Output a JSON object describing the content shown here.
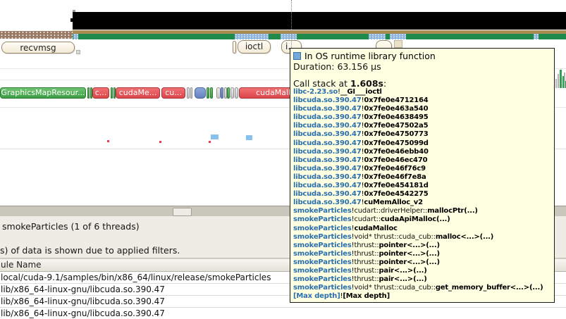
{
  "timeline": {
    "buttons": {
      "recvmsg": "recvmsg",
      "ioctl": "ioctl",
      "i_truncated": "i...",
      "dots": "..."
    },
    "bars": [
      "GraphicsMapResour...",
      "c...",
      "cudaMe...",
      "cu...",
      "cudaMalloc"
    ]
  },
  "tooltip": {
    "title": "In OS runtime library function",
    "duration": "Duration: 63.156 µs",
    "callstack_prefix": "Call stack at ",
    "callstack_time": "1.608s",
    "callstack_suffix": ":",
    "bang": "!",
    "stack": [
      {
        "module": "libc-2.23.so",
        "mid": "",
        "fn": "__GI___ioctl"
      },
      {
        "module": "libcuda.so.390.47",
        "mid": "",
        "fn": "0x7fe0e4712164"
      },
      {
        "module": "libcuda.so.390.47",
        "mid": "",
        "fn": "0x7fe0e463a540"
      },
      {
        "module": "libcuda.so.390.47",
        "mid": "",
        "fn": "0x7fe0e4638495"
      },
      {
        "module": "libcuda.so.390.47",
        "mid": "",
        "fn": "0x7fe0e47502a5"
      },
      {
        "module": "libcuda.so.390.47",
        "mid": "",
        "fn": "0x7fe0e4750773"
      },
      {
        "module": "libcuda.so.390.47",
        "mid": "",
        "fn": "0x7fe0e475099d"
      },
      {
        "module": "libcuda.so.390.47",
        "mid": "",
        "fn": "0x7fe0e46ebb40"
      },
      {
        "module": "libcuda.so.390.47",
        "mid": "",
        "fn": "0x7fe0e46ec470"
      },
      {
        "module": "libcuda.so.390.47",
        "mid": "",
        "fn": "0x7fe0e46f76c9"
      },
      {
        "module": "libcuda.so.390.47",
        "mid": "",
        "fn": "0x7fe0e46f7e8a"
      },
      {
        "module": "libcuda.so.390.47",
        "mid": "",
        "fn": "0x7fe0e454181d"
      },
      {
        "module": "libcuda.so.390.47",
        "mid": "",
        "fn": "0x7fe0e4542275"
      },
      {
        "module": "libcuda.so.390.47",
        "mid": "",
        "fn": "cuMemAlloc_v2"
      },
      {
        "module": "smokeParticles",
        "mid": "cudart::driverHelper::",
        "fn": "mallocPtr(...)"
      },
      {
        "module": "smokeParticles",
        "mid": "cudart::",
        "fn": "cudaApiMalloc(...)"
      },
      {
        "module": "smokeParticles",
        "mid": "",
        "fn": "cudaMalloc"
      },
      {
        "module": "smokeParticles",
        "mid": "void* thrust::cuda_cub::",
        "fn": "malloc<...>(...)"
      },
      {
        "module": "smokeParticles",
        "mid": "thrust::",
        "fn": "pointer<...>(...)"
      },
      {
        "module": "smokeParticles",
        "mid": "thrust::",
        "fn": "pointer<...>(...)"
      },
      {
        "module": "smokeParticles",
        "mid": "thrust::",
        "fn": "pointer<...>(...)"
      },
      {
        "module": "smokeParticles",
        "mid": "thrust::",
        "fn": "pair<...>(...)"
      },
      {
        "module": "smokeParticles",
        "mid": "thrust::",
        "fn": "pair<...>(...)"
      },
      {
        "module": "smokeParticles",
        "mid": "void* thrust::cuda_cub::",
        "fn": "get_memory_buffer<...>(...)"
      },
      {
        "module": "[Max depth]",
        "mid": "",
        "fn": "[Max depth]"
      }
    ]
  },
  "bottom": {
    "thread_info": "smokeParticles (1 of 6 threads)",
    "filter_notice": "s) of data is shown due to applied filters.",
    "table": {
      "header": "ule Name",
      "rows": [
        "local/cuda-9.1/samples/bin/x86_64/linux/release/smokeParticles",
        "lib/x86_64-linux-gnu/libcuda.so.390.47",
        "lib/x86_64-linux-gnu/libcuda.so.390.47",
        "lib/x86_64-linux-gnu/libcuda.so.390.47"
      ]
    }
  },
  "colors": {
    "tooltip_bg": "#ffffe1",
    "module_link_blue": "#2a6fad",
    "timeline_green": "#1e8b4b",
    "timeline_tan": "#a98c54",
    "dotted_track_brown": "#9a7a66",
    "dotted_segment_blue": "#8ab4de",
    "interval_red": "#dd4549",
    "interval_green": "#3d9e44",
    "interval_blue": "#6281bf",
    "marker_red": "#f0384a",
    "marker_blue": "#85c1ec"
  }
}
